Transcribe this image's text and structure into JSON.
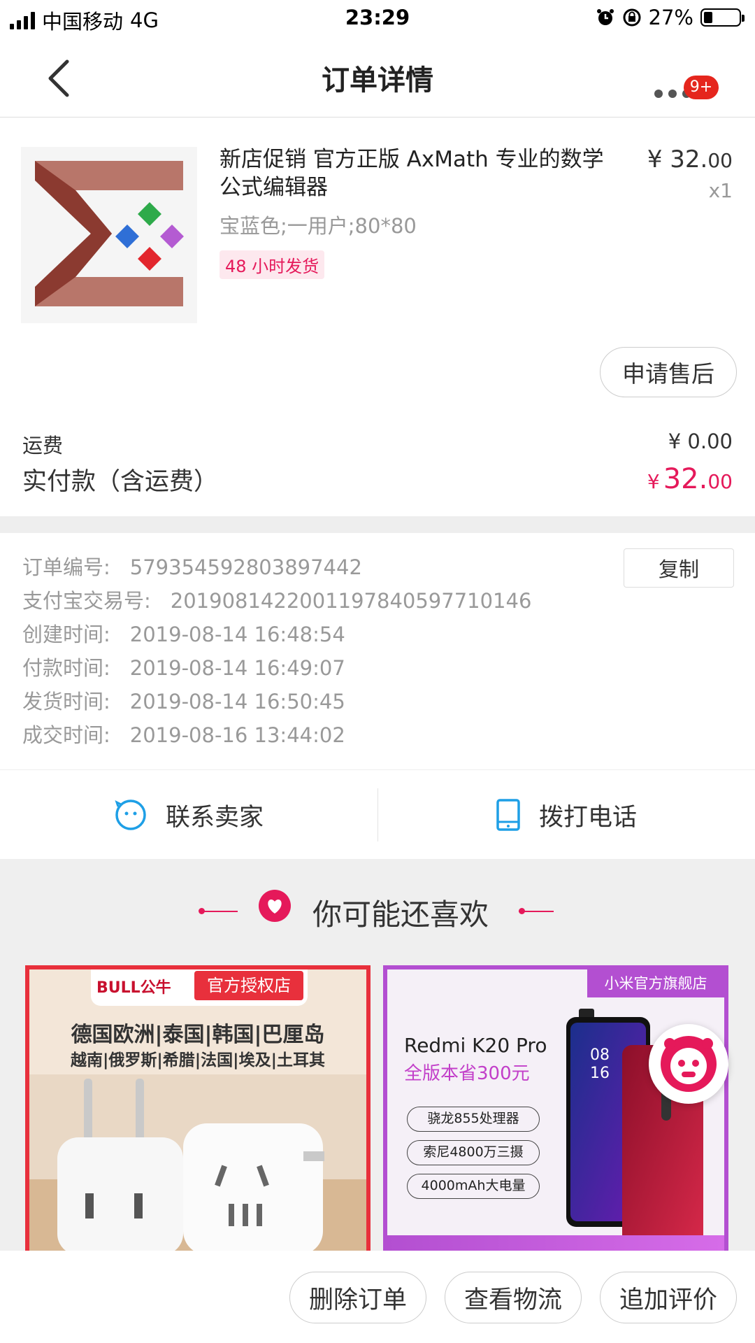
{
  "status_bar": {
    "carrier": "中国移动",
    "network": "4G",
    "time": "23:29",
    "battery": "27%"
  },
  "nav": {
    "title": "订单详情",
    "badge": "9+"
  },
  "product": {
    "title": "新店促销 官方正版 AxMath 专业的数学公式编辑器",
    "spec": "宝蓝色;一用户;80*80",
    "tag": "48 小时发货",
    "price_main": "¥ 32.",
    "price_dec": "00",
    "quantity": "x1",
    "after_sale_label": "申请售后"
  },
  "shipping": {
    "label": "运费",
    "value": "¥ 0.00"
  },
  "total": {
    "label": "实付款（含运费）",
    "currency": "¥",
    "int": "32.",
    "dec": "00"
  },
  "order_info": {
    "copy_label": "复制",
    "rows": [
      {
        "label": "订单编号:",
        "value": "579354592803897442"
      },
      {
        "label": "支付宝交易号:",
        "value": "2019081422001197840597710146"
      },
      {
        "label": "创建时间:",
        "value": "2019-08-14 16:48:54"
      },
      {
        "label": "付款时间:",
        "value": "2019-08-14 16:49:07"
      },
      {
        "label": "发货时间:",
        "value": "2019-08-14 16:50:45"
      },
      {
        "label": "成交时间:",
        "value": "2019-08-16 13:44:02"
      }
    ]
  },
  "contact": {
    "seller_label": "联系卖家",
    "phone_label": "拨打电话"
  },
  "recommend": {
    "title": "你可能还喜欢",
    "card1": {
      "brand": "BULL公牛",
      "store": "官方授权店",
      "line1": "德国欧洲|泰国|韩国|巴厘岛",
      "line2": "越南|俄罗斯|希腊|法国|埃及|土耳其"
    },
    "card2": {
      "store": "小米官方旗舰店",
      "model": "Redmi K20 Pro",
      "promo": "全版本省300元",
      "feature1": "骁龙855处理器",
      "feature2": "索尼4800万三摄",
      "feature3": "4000mAh大电量",
      "phone_time1": "08",
      "phone_time2": "16"
    }
  },
  "bottom_bar": {
    "delete_label": "删除订单",
    "logistics_label": "查看物流",
    "review_label": "追加评价"
  },
  "colors": {
    "accent": "#e5195a",
    "badge": "#e5261d",
    "contact_icon": "#1e9fe6"
  }
}
